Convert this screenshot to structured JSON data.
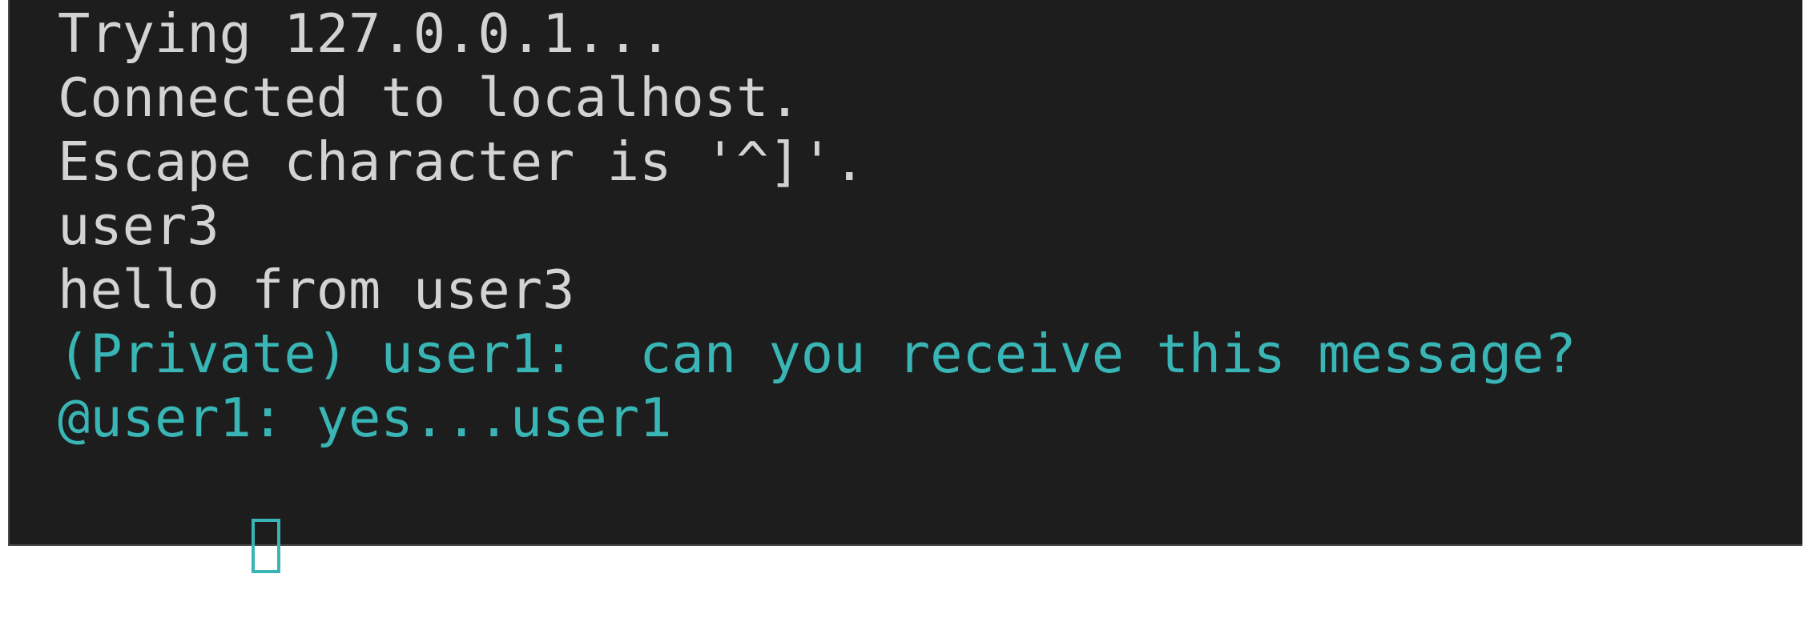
{
  "terminal": {
    "lines": [
      {
        "text": "Trying 127.0.0.1...",
        "style": "normal"
      },
      {
        "text": "Connected to localhost.",
        "style": "normal"
      },
      {
        "text": "Escape character is '^]'.",
        "style": "normal"
      },
      {
        "text": "user3",
        "style": "normal"
      },
      {
        "text": "hello from user3",
        "style": "normal"
      },
      {
        "text": "(Private) user1:  can you receive this message?",
        "style": "cyan"
      },
      {
        "text": "@user1: yes...user1",
        "style": "cyan"
      }
    ],
    "colors": {
      "background": "#1d1d1d",
      "text": "#d3d3d3",
      "highlight": "#39b5b5"
    }
  }
}
